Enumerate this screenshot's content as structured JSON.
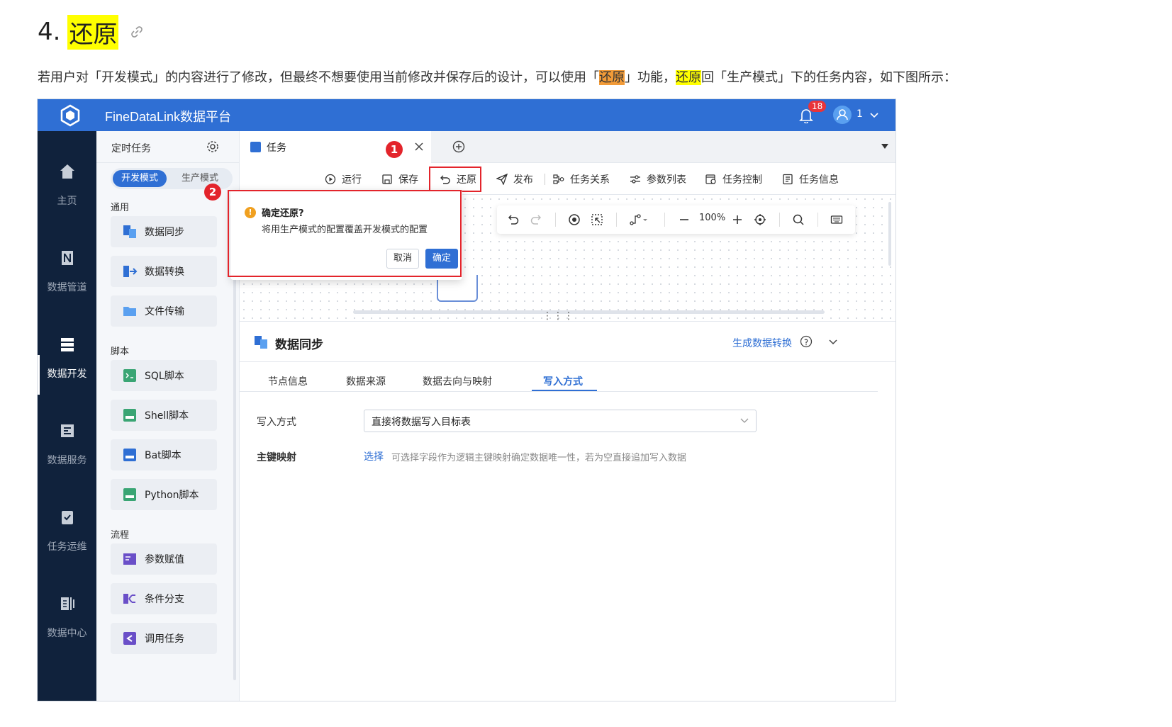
{
  "doc": {
    "title_prefix": "4.",
    "title_highlight": "还原",
    "paragraph_parts": [
      "若用户对「开发模式」的内容进行了修改，但最终不想要使用当前修改并保存后的设计，可以使用「",
      "还原",
      "」功能，",
      "还原",
      "回「生产模式」下的任务内容，如下图所示："
    ],
    "highlight_colors": {
      "orange": "#f29b38",
      "yellow": "#ffff00"
    }
  },
  "app": {
    "title": "FineDataLink数据平台",
    "notifications": "18",
    "user": "1",
    "brand_color": "#2f6fd4",
    "nav_bg": "#10223c"
  },
  "left_nav": [
    {
      "label": "主页",
      "icon": "home-icon"
    },
    {
      "label": "数据管道",
      "icon": "pipeline-icon"
    },
    {
      "label": "数据开发",
      "icon": "dev-icon",
      "active": true
    },
    {
      "label": "数据服务",
      "icon": "service-icon"
    },
    {
      "label": "任务运维",
      "icon": "ops-icon"
    },
    {
      "label": "数据中心",
      "icon": "datacenter-icon"
    }
  ],
  "panel": {
    "header": "定时任务",
    "modes": [
      "开发模式",
      "生产模式"
    ],
    "sections": [
      {
        "title": "通用",
        "items": [
          "数据同步",
          "数据转换",
          "文件传输"
        ]
      },
      {
        "title": "脚本",
        "items": [
          "SQL脚本",
          "Shell脚本",
          "Bat脚本",
          "Python脚本"
        ]
      },
      {
        "title": "流程",
        "items": [
          "参数赋值",
          "条件分支",
          "调用任务"
        ]
      }
    ]
  },
  "tab": {
    "label": "任务"
  },
  "toolbar": {
    "run": "运行",
    "save": "保存",
    "restore": "还原",
    "publish": "发布",
    "relations": "任务关系",
    "params": "参数列表",
    "control": "任务控制",
    "info": "任务信息"
  },
  "markers": [
    "1",
    "2"
  ],
  "canvas": {
    "zoom": "100%"
  },
  "dialog": {
    "title": "确定还原?",
    "message": "将用生产模式的配置覆盖开发模式的配置",
    "cancel": "取消",
    "confirm": "确定"
  },
  "detail": {
    "title": "数据同步",
    "generate_link": "生成数据转换",
    "tabs": [
      "节点信息",
      "数据来源",
      "数据去向与映射",
      "写入方式"
    ],
    "active_tab": "写入方式",
    "write_mode_label": "写入方式",
    "write_mode_value": "直接将数据写入目标表",
    "pk_label": "主键映射",
    "pk_link": "选择",
    "pk_hint": "可选择字段作为逻辑主键映射确定数据唯一性，若为空直接追加写入数据"
  }
}
